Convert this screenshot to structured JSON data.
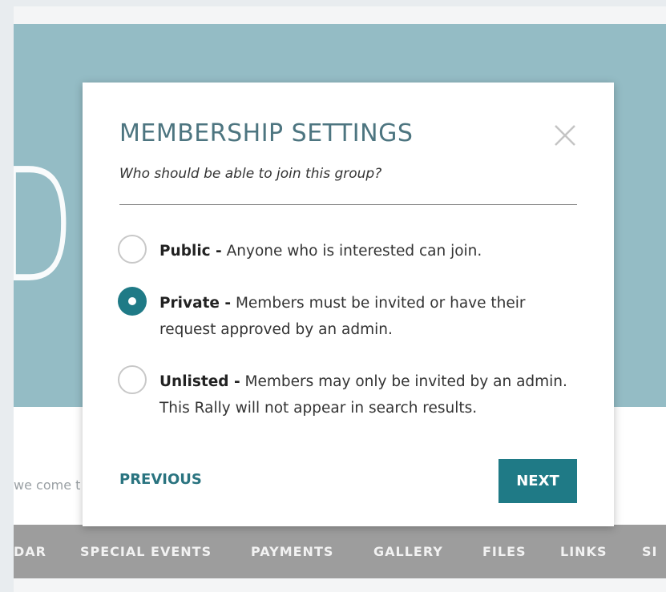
{
  "background": {
    "hero_text": "DOG DAY",
    "tagline": "we come t",
    "nav_items": [
      "DAR",
      "SPECIAL EVENTS",
      "PAYMENTS",
      "GALLERY",
      "FILES",
      "LINKS",
      "SI"
    ]
  },
  "modal": {
    "title": "MEMBERSHIP SETTINGS",
    "subtitle": "Who should be able to join this group?",
    "close_icon": "close-icon",
    "options": [
      {
        "label": "Public -",
        "description": " Anyone who is interested can join.",
        "selected": false
      },
      {
        "label": "Private -",
        "description": " Members must be invited or have their request approved by an admin.",
        "selected": true
      },
      {
        "label": "Unlisted -",
        "description": " Members may only be invited by an admin. This Rally will not appear in search results.",
        "selected": false
      }
    ],
    "previous_label": "PREVIOUS",
    "next_label": "NEXT"
  },
  "colors": {
    "hero_bg": "#94bcc5",
    "accent": "#1f7a86",
    "title": "#4d7580",
    "nav_bg": "#9d9d9d"
  }
}
